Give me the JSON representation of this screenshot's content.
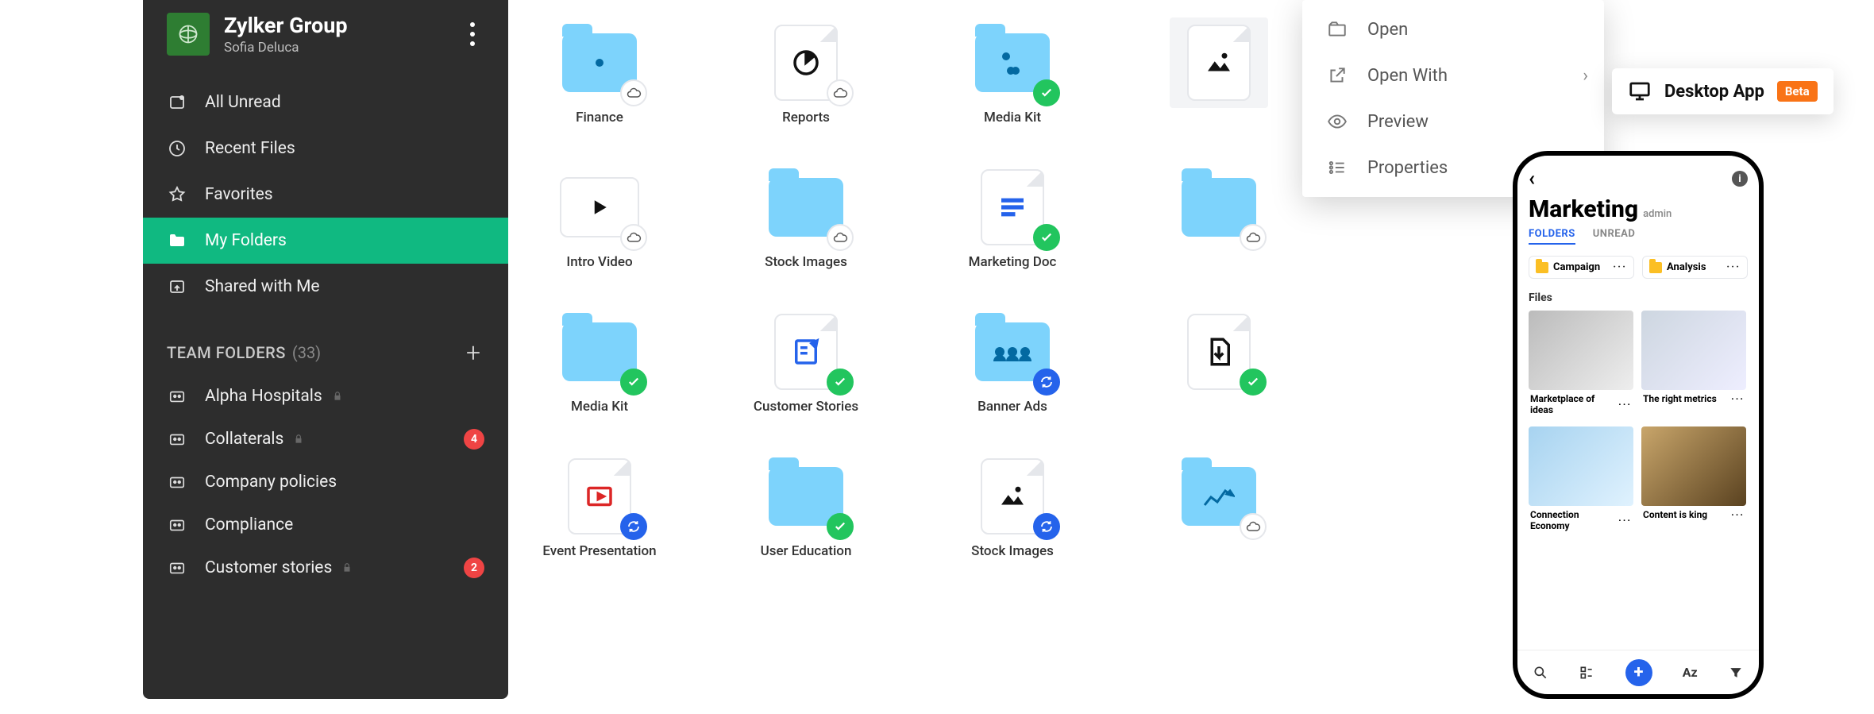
{
  "sidebar": {
    "logo_text": "Zylker Group",
    "org": "Zylker Group",
    "user": "Sofia Deluca",
    "nav": [
      {
        "label": "All Unread",
        "icon": "inbox-icon"
      },
      {
        "label": "Recent Files",
        "icon": "clock-icon"
      },
      {
        "label": "Favorites",
        "icon": "star-icon"
      },
      {
        "label": "My Folders",
        "icon": "folder-icon",
        "active": true
      },
      {
        "label": "Shared with Me",
        "icon": "share-icon"
      }
    ],
    "team_section_label": "TEAM FOLDERS",
    "team_section_count": "(33)",
    "team": [
      {
        "label": "Alpha Hospitals",
        "locked": true
      },
      {
        "label": "Collaterals",
        "locked": true,
        "badge": "4"
      },
      {
        "label": "Company policies"
      },
      {
        "label": "Compliance"
      },
      {
        "label": "Customer stories",
        "locked": true,
        "badge": "2"
      }
    ]
  },
  "files": [
    {
      "label": "Finance",
      "kind": "folder",
      "badge": "cloud",
      "decor": "one-dot"
    },
    {
      "label": "Reports",
      "kind": "doc-pie",
      "badge": "cloud"
    },
    {
      "label": "Media Kit",
      "kind": "folder",
      "badge": "green",
      "decor": "tri-dot"
    },
    {
      "label": "",
      "kind": "image",
      "selected": true
    },
    {
      "label": "Intro Video",
      "kind": "video",
      "badge": "cloud"
    },
    {
      "label": "Stock Images",
      "kind": "folder",
      "badge": "cloud"
    },
    {
      "label": "Marketing Doc",
      "kind": "doc-text",
      "badge": "green"
    },
    {
      "label": "",
      "kind": "folder",
      "badge": "cloud"
    },
    {
      "label": "Media Kit",
      "kind": "folder",
      "badge": "green"
    },
    {
      "label": "Customer Stories",
      "kind": "doc-form",
      "badge": "green"
    },
    {
      "label": "Banner Ads",
      "kind": "folder",
      "badge": "blue",
      "decor": "people"
    },
    {
      "label": "",
      "kind": "doc-pdf",
      "badge": "green"
    },
    {
      "label": "Event Presentation",
      "kind": "doc-slides",
      "badge": "blue"
    },
    {
      "label": "User Education",
      "kind": "folder",
      "badge": "green"
    },
    {
      "label": "Stock Images",
      "kind": "image",
      "badge": "blue"
    },
    {
      "label": "",
      "kind": "folder",
      "badge": "cloud",
      "decor": "chart"
    }
  ],
  "context_menu": {
    "items": [
      {
        "label": "Open",
        "icon": "open-icon"
      },
      {
        "label": "Open With",
        "icon": "external-icon",
        "submenu": true
      },
      {
        "label": "Preview",
        "icon": "eye-icon"
      },
      {
        "label": "Properties",
        "icon": "list-icon"
      }
    ]
  },
  "desktop_pill": {
    "label": "Desktop App",
    "tag": "Beta"
  },
  "phone": {
    "title": "Marketing",
    "role": "admin",
    "tabs": [
      "FOLDERS",
      "UNREAD"
    ],
    "active_tab": 0,
    "chips": [
      "Campaign",
      "Analysis"
    ],
    "files_label": "Files",
    "cards": [
      {
        "title": "Marketplace of ideas"
      },
      {
        "title": "The right metrics"
      },
      {
        "title": "Connection Economy"
      },
      {
        "title": "Content is king"
      }
    ],
    "sort_label": "Az"
  }
}
